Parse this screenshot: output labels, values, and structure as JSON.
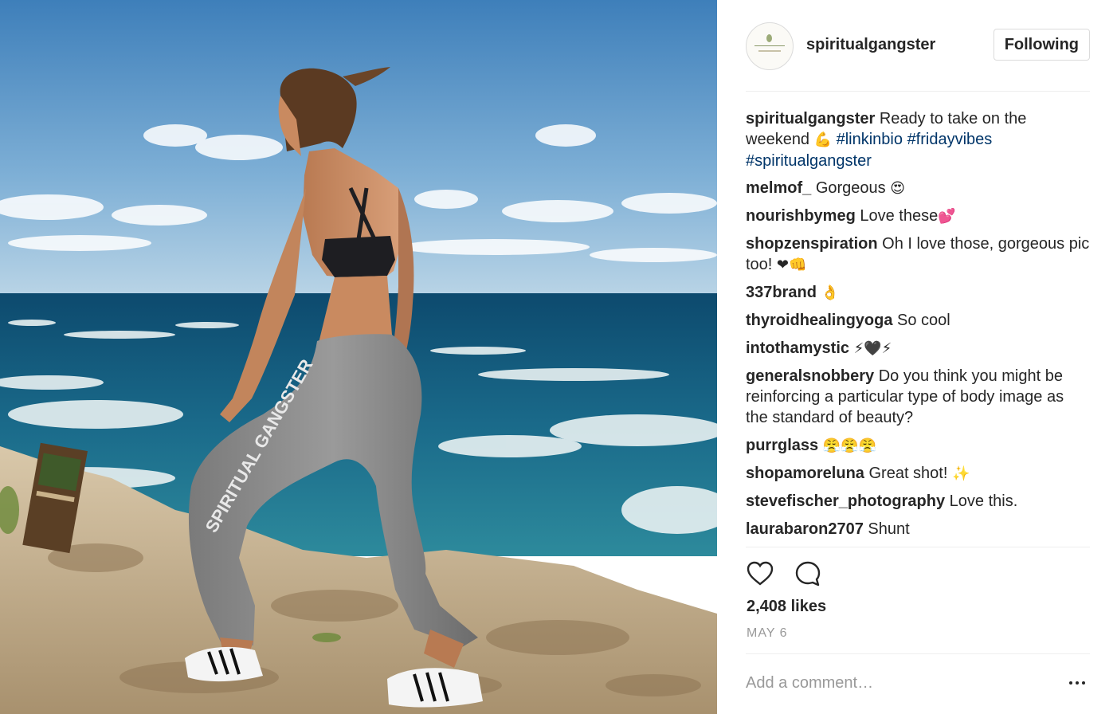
{
  "post": {
    "username": "spiritualgangster",
    "follow_label": "Following",
    "image_alt": "spiritualgangster post photo",
    "leggings_text": "SPIRITUAL GANGSTER"
  },
  "caption": {
    "username": "spiritualgangster",
    "text": "Ready to take on the weekend",
    "emoji": "💪",
    "tags": [
      "#linkinbio",
      "#fridayvibes",
      "#spiritualgangster"
    ]
  },
  "comments": [
    {
      "user": "melmof_",
      "text": "Gorgeous",
      "emoji": "😍"
    },
    {
      "user": "nourishbymeg",
      "text": "Love these",
      "emoji": "💕"
    },
    {
      "user": "shopzenspiration",
      "text": "Oh I love those, gorgeous pic too!",
      "emoji": "❤👊"
    },
    {
      "user": "337brand",
      "text": "",
      "emoji": "👌"
    },
    {
      "user": "thyroidhealingyoga",
      "text": "So cool",
      "emoji": ""
    },
    {
      "user": "intothamystic",
      "text": "",
      "emoji": "⚡🖤⚡"
    },
    {
      "user": "generalsnobbery",
      "text": "Do you think you might be reinforcing a particular type of body image as the standard of beauty?",
      "emoji": ""
    },
    {
      "user": "purrglass",
      "text": "",
      "emoji": "😤😤😤"
    },
    {
      "user": "shopamoreluna",
      "text": "Great shot!",
      "emoji": "✨"
    },
    {
      "user": "stevefischer_photography",
      "text": "Love this.",
      "emoji": ""
    },
    {
      "user": "laurabaron2707",
      "text": "Shunt",
      "emoji": ""
    }
  ],
  "actions": {
    "like_icon": "heart-icon",
    "comment_icon": "comment-bubble-icon",
    "likes": "2,408 likes",
    "date": "MAY 6"
  },
  "composer": {
    "placeholder": "Add a comment…",
    "more_icon": "more-options-icon"
  },
  "colors": {
    "text": "#262626",
    "hashtag": "#003569",
    "muted": "#999999",
    "border": "#dbdbdb"
  }
}
